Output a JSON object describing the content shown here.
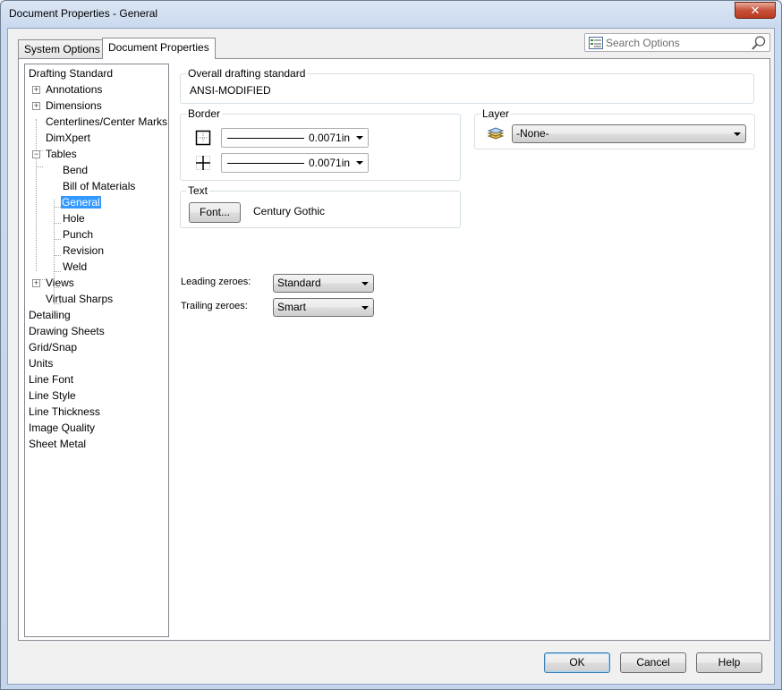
{
  "window": {
    "title": "Document Properties - General",
    "close_glyph": "✕"
  },
  "tabs": [
    {
      "label": "System Options"
    },
    {
      "label": "Document Properties"
    }
  ],
  "search": {
    "placeholder": "Search Options"
  },
  "tree": {
    "items": [
      {
        "label": "Drafting Standard"
      },
      {
        "label": "Annotations",
        "expander": "+"
      },
      {
        "label": "Dimensions",
        "expander": "+"
      },
      {
        "label": "Centerlines/Center Marks"
      },
      {
        "label": "DimXpert"
      },
      {
        "label": "Tables",
        "expander": "−"
      },
      {
        "label": "Bend"
      },
      {
        "label": "Bill of Materials"
      },
      {
        "label": "General",
        "selected": true
      },
      {
        "label": "Hole"
      },
      {
        "label": "Punch"
      },
      {
        "label": "Revision"
      },
      {
        "label": "Weld"
      },
      {
        "label": "Views",
        "expander": "+"
      },
      {
        "label": "Virtual Sharps"
      },
      {
        "label": "Detailing"
      },
      {
        "label": "Drawing Sheets"
      },
      {
        "label": "Grid/Snap"
      },
      {
        "label": "Units"
      },
      {
        "label": "Line Font"
      },
      {
        "label": "Line Style"
      },
      {
        "label": "Line Thickness"
      },
      {
        "label": "Image Quality"
      },
      {
        "label": "Sheet Metal"
      }
    ]
  },
  "overall": {
    "legend": "Overall drafting standard",
    "value": "ANSI-MODIFIED"
  },
  "border": {
    "legend": "Border",
    "outer_thickness": "0.0071in",
    "inner_thickness": "0.0071in"
  },
  "layer": {
    "legend": "Layer",
    "value": "-None-"
  },
  "text": {
    "legend": "Text",
    "font_button": "Font...",
    "font_name": "Century Gothic"
  },
  "zeroes": {
    "leading_label": "Leading zeroes:",
    "leading_value": "Standard",
    "trailing_label": "Trailing zeroes:",
    "trailing_value": "Smart"
  },
  "footer": {
    "ok": "OK",
    "cancel": "Cancel",
    "help": "Help"
  },
  "colors": {
    "selection": "#3399ff",
    "accent": "#3c7fb1"
  }
}
